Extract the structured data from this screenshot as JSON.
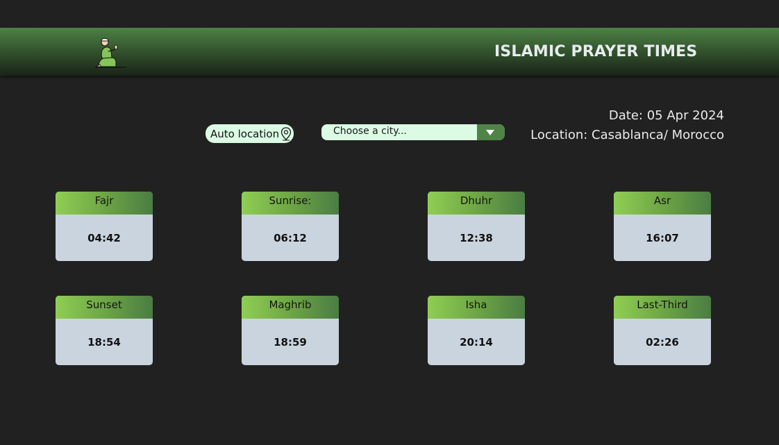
{
  "header": {
    "logo_icon": "praying-person-icon",
    "title": "ISLAMIC PRAYER TIMES"
  },
  "controls": {
    "auto_location_label": "Auto location",
    "auto_location_icon": "location-pin-icon",
    "city_placeholder": "Choose a city...",
    "city_dropdown_icon": "chevron-down-icon"
  },
  "info": {
    "date": "Date: 05 Apr 2024",
    "location": "Location: Casablanca/ Morocco"
  },
  "prayers": [
    {
      "name": "Fajr",
      "time": "04:42"
    },
    {
      "name": "Sunrise:",
      "time": "06:12"
    },
    {
      "name": "Dhuhr",
      "time": "12:38"
    },
    {
      "name": "Asr",
      "time": "16:07"
    },
    {
      "name": "Sunset",
      "time": "18:54"
    },
    {
      "name": "Maghrib",
      "time": "18:59"
    },
    {
      "name": "Isha",
      "time": "20:14"
    },
    {
      "name": "Last-Third",
      "time": "02:26"
    }
  ],
  "colors": {
    "background": "#212121",
    "header_green": "#4d8244",
    "card_body": "#cad4df",
    "card_head_light": "#8fce54",
    "card_head_dark": "#4a7d43",
    "control_bg": "#dbfbe4"
  }
}
